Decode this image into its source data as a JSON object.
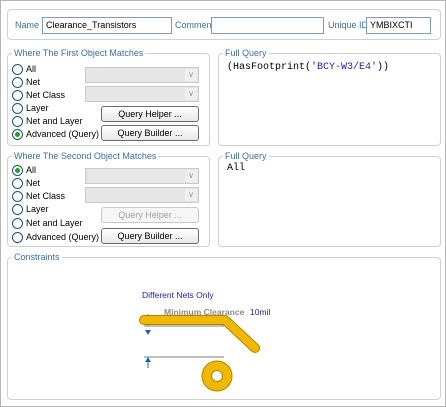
{
  "header": {
    "name_label": "Name",
    "name_value": "Clearance_Transistors",
    "comment_label": "Comment",
    "comment_value": "",
    "uid_label": "Unique ID",
    "uid_value": "YMBIXCTI"
  },
  "first_match": {
    "title": "Where The First Object Matches",
    "options": [
      "All",
      "Net",
      "Net Class",
      "Layer",
      "Net and Layer",
      "Advanced (Query)"
    ],
    "selected": "Advanced (Query)",
    "query_helper_label": "Query Helper ...",
    "query_builder_label": "Query Builder ..."
  },
  "first_query": {
    "title": "Full Query",
    "prefix": "(HasFootprint(",
    "string": "'BCY-W3/E4'",
    "suffix": "))"
  },
  "second_match": {
    "title": "Where The Second Object Matches",
    "options": [
      "All",
      "Net",
      "Net Class",
      "Layer",
      "Net and Layer",
      "Advanced (Query)"
    ],
    "selected": "All",
    "query_helper_label": "Query Helper ...",
    "query_builder_label": "Query Builder ..."
  },
  "second_query": {
    "title": "Full Query",
    "text": "All"
  },
  "constraints": {
    "title": "Constraints",
    "net_scope": "Different Nets Only",
    "min_clearance_label": "Minimum Clearance",
    "min_clearance_value": "10mil"
  },
  "colors": {
    "group_title": "#3a6ea5",
    "query_string": "#1f1fa6",
    "copper": "#f2b800",
    "copper_edge": "#b08400",
    "radio_dot": "#21a121"
  }
}
